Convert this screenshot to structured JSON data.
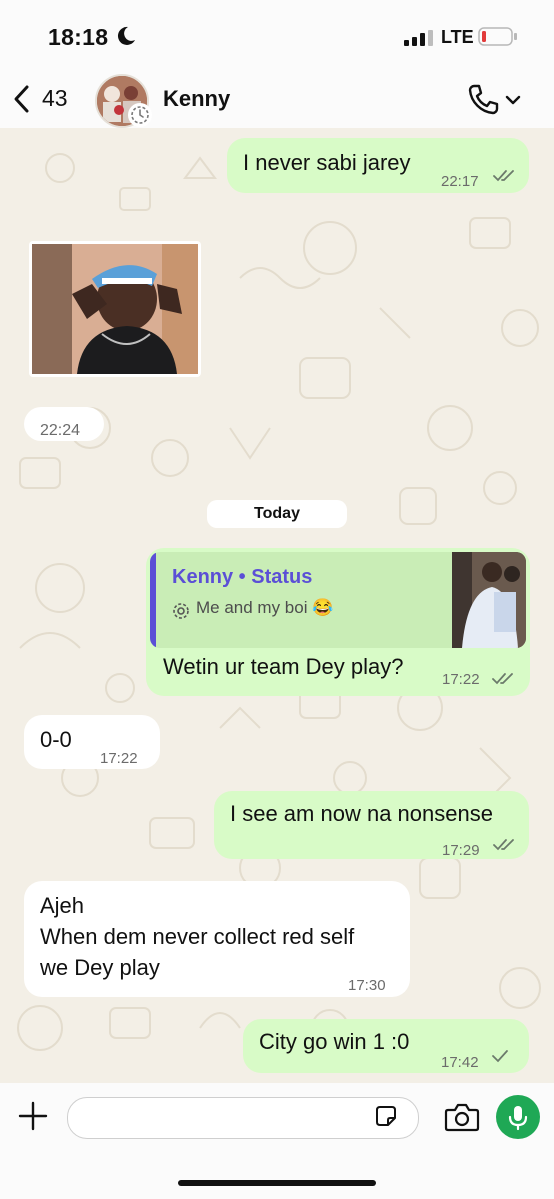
{
  "status_bar": {
    "time": "18:18",
    "network": "LTE"
  },
  "header": {
    "back_count": "43",
    "contact_name": "Kenny"
  },
  "messages": {
    "m1": {
      "text": "I never sabi jarey",
      "time": "22:17"
    },
    "m2": {
      "time": "22:24"
    },
    "day_label": "Today",
    "m3": {
      "reply_title": "Kenny • Status",
      "reply_text": "Me and my boi 😂",
      "text": "Wetin ur team Dey play?",
      "time": "17:22"
    },
    "m4": {
      "text": "0-0",
      "time": "17:22"
    },
    "m5": {
      "text": "I see am now na nonsense",
      "time": "17:29"
    },
    "m6": {
      "line1": "Ajeh",
      "line2": "When dem never collect red self",
      "line3": "we Dey play",
      "time": "17:30"
    },
    "m7": {
      "text": "City go win 1 :0",
      "time": "17:42"
    }
  },
  "colors": {
    "outgoing": "#d8fbc7",
    "incoming": "#ffffff",
    "read_tick": "#53bdeb",
    "mic": "#1fa855",
    "reply_accent": "#5b4fd6"
  },
  "icons": [
    "moon-icon",
    "signal-icon",
    "battery-icon",
    "back-chevron-icon",
    "phone-icon",
    "chevron-down-icon",
    "plus-icon",
    "sticker-icon",
    "camera-icon",
    "mic-icon",
    "double-tick-icon",
    "single-tick-icon",
    "status-icon"
  ]
}
